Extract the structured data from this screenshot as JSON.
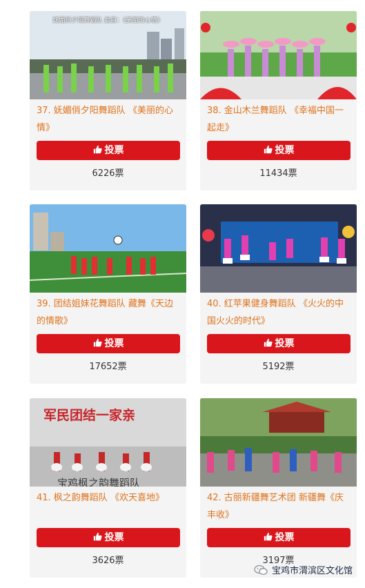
{
  "vote_button_label": "投票",
  "cards": [
    {
      "title": "37. 妩媚俏夕阳舞蹈队 《美丽的心情》",
      "votes": "6226票",
      "thumb_caption": "妩媚俏夕阳舞蹈队  曲目：《美丽的心情》"
    },
    {
      "title": "38. 金山木兰舞蹈队 《幸福中国一起走》",
      "votes": "11434票"
    },
    {
      "title": "39. 团结姐妹花舞蹈队 藏舞《天边的情歌》",
      "votes": "17652票"
    },
    {
      "title": "40. 红苹果健身舞蹈队 《火火的中国火火的时代》",
      "votes": "5192票"
    },
    {
      "title": "41. 枫之韵舞蹈队 《欢天喜地》",
      "votes": "3626票",
      "thumb_caption": "军民团结一家亲",
      "thumb_caption2": "宝鸡枫之韵舞蹈队"
    },
    {
      "title": "42. 古丽新疆舞艺术团 新疆舞《庆丰收》",
      "votes": "3197票"
    }
  ],
  "watermark": "宝鸡市渭滨区文化馆",
  "colors": {
    "accent_red": "#d9161b",
    "title_orange": "#e0731d"
  },
  "icons": {
    "vote": "thumbs-up-icon",
    "watermark": "wechat-icon"
  }
}
